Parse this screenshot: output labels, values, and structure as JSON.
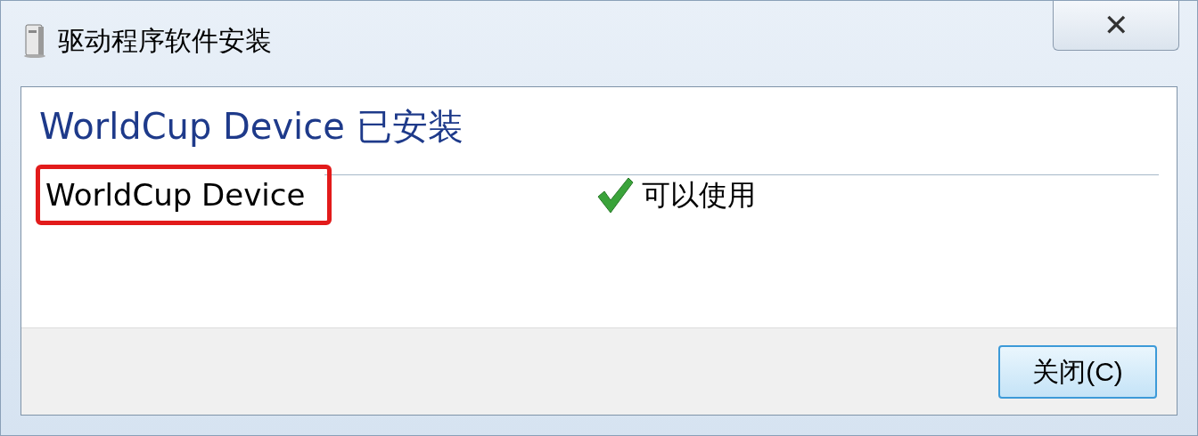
{
  "window": {
    "title": "驱动程序软件安装",
    "close_label": "✕"
  },
  "heading": "WorldCup Device 已安装",
  "devices": [
    {
      "name": "WorldCup Device",
      "highlighted": true,
      "status": "可以使用",
      "status_ok": true
    }
  ],
  "buttons": [
    {
      "label": "关闭(C)",
      "selected": true
    }
  ]
}
